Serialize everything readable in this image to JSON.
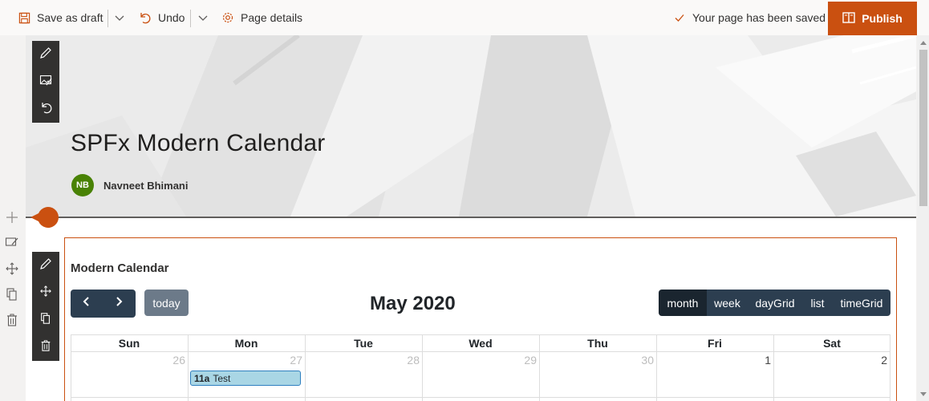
{
  "commandbar": {
    "save_draft_label": "Save as draft",
    "undo_label": "Undo",
    "page_details_label": "Page details",
    "status_text": "Your page has been saved",
    "publish_label": "Publish"
  },
  "hero": {
    "title": "SPFx Modern Calendar",
    "author_initials": "NB",
    "author_name": "Navneet Bhimani",
    "avatar_color": "#498205"
  },
  "webpart": {
    "title": "Modern Calendar",
    "today_label": "today",
    "current_month": "May 2020",
    "views": [
      {
        "label": "month",
        "active": true
      },
      {
        "label": "week",
        "active": false
      },
      {
        "label": "dayGrid",
        "active": false
      },
      {
        "label": "list",
        "active": false
      },
      {
        "label": "timeGrid",
        "active": false
      }
    ],
    "days_of_week": [
      "Sun",
      "Mon",
      "Tue",
      "Wed",
      "Thu",
      "Fri",
      "Sat"
    ],
    "first_week": [
      {
        "num": "26",
        "other_month": true
      },
      {
        "num": "27",
        "other_month": true
      },
      {
        "num": "28",
        "other_month": true
      },
      {
        "num": "29",
        "other_month": true
      },
      {
        "num": "30",
        "other_month": true
      },
      {
        "num": "1",
        "other_month": false
      },
      {
        "num": "2",
        "other_month": false
      }
    ],
    "event": {
      "time": "11a",
      "title": "Test",
      "day": "27"
    }
  },
  "colors": {
    "accent": "#ca5010",
    "calendar_button": "#2c3e50",
    "event_bg": "#a9d6e5"
  }
}
